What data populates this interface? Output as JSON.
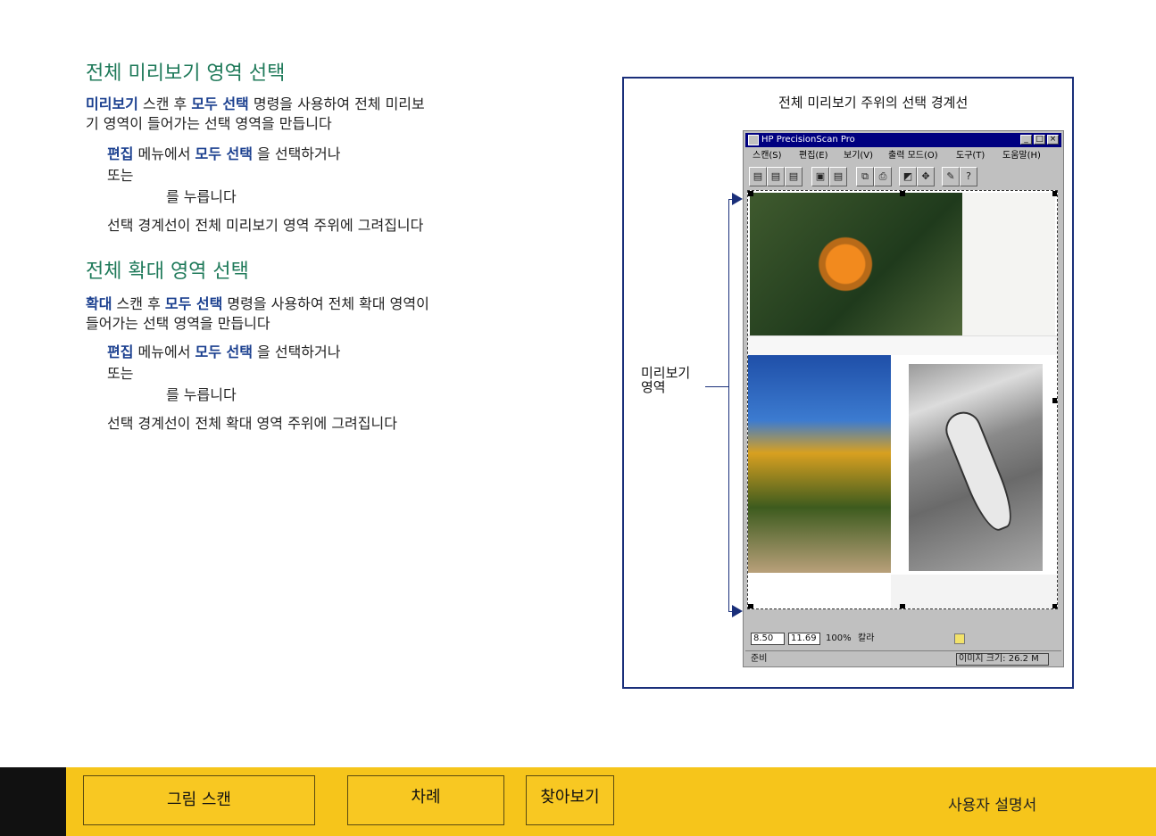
{
  "sections": [
    {
      "heading": "전체 미리보기 영역 선택",
      "intro": [
        {
          "text": "미리보기",
          "kw": true
        },
        {
          "text": "  스캔 후 ",
          "kw": false
        },
        {
          "text": "모두 선택",
          "kw": true
        },
        {
          "text": " 명령을 사용하여  전체 미리보",
          "kw": false
        }
      ],
      "intro_line2": "기 영역이  들어가는  선택 영역을  만듭니다",
      "step1_kw1": "편집",
      "step1_mid": " 메뉴에서 ",
      "step1_kw2": "모두 선택",
      "step1_end": " 을 선택하거나",
      "step2": "또는",
      "step3": "를 누릅니다",
      "step4": "선택 경계선이 전체 미리보기 영역 주위에 그려집니다"
    },
    {
      "heading": "전체 확대 영역 선택",
      "intro": [
        {
          "text": "확대",
          "kw": true
        },
        {
          "text": " 스캔 후 ",
          "kw": false
        },
        {
          "text": "모두 선택",
          "kw": true
        },
        {
          "text": " 명령을 사용하여  전체 확대 영역이",
          "kw": false
        }
      ],
      "intro_line2": "들어가는  선택  영역을 만듭니다",
      "step1_kw1": "편집",
      "step1_mid": " 메뉴에서 ",
      "step1_kw2": "모두 선택",
      "step1_end": " 을 선택하거나",
      "step2": "또는",
      "step3": "를 누릅니다",
      "step4": "선택 경계선이 전체 확대 영역 주위에 그려집니다"
    }
  ],
  "figure": {
    "caption": "전체 미리보기 주위의 선택 경계선",
    "callout_line1": "미리보기",
    "callout_line2": "영역",
    "window": {
      "title": "HP PrecisionScan Pro",
      "menus": [
        "스캔(S)",
        "편집(E)",
        "보기(V)",
        "출력 모드(O)",
        "도구(T)",
        "도움말(H)"
      ],
      "width_value": "8.50",
      "height_value": "11.69",
      "zoom": "100%",
      "color_mode": "칼라",
      "status": "준비",
      "image_size": "이미지 크기: 26.2 M"
    }
  },
  "footer": {
    "btn_scan": "그림 스캔",
    "btn_toc": "차례",
    "btn_index": "찾아보기",
    "title": "사용자 설명서"
  },
  "colors": {
    "heading": "#1f7a5a",
    "keyword": "#1a3f8f",
    "footer_bg": "#f6c51b",
    "frame": "#1a2f7a"
  }
}
